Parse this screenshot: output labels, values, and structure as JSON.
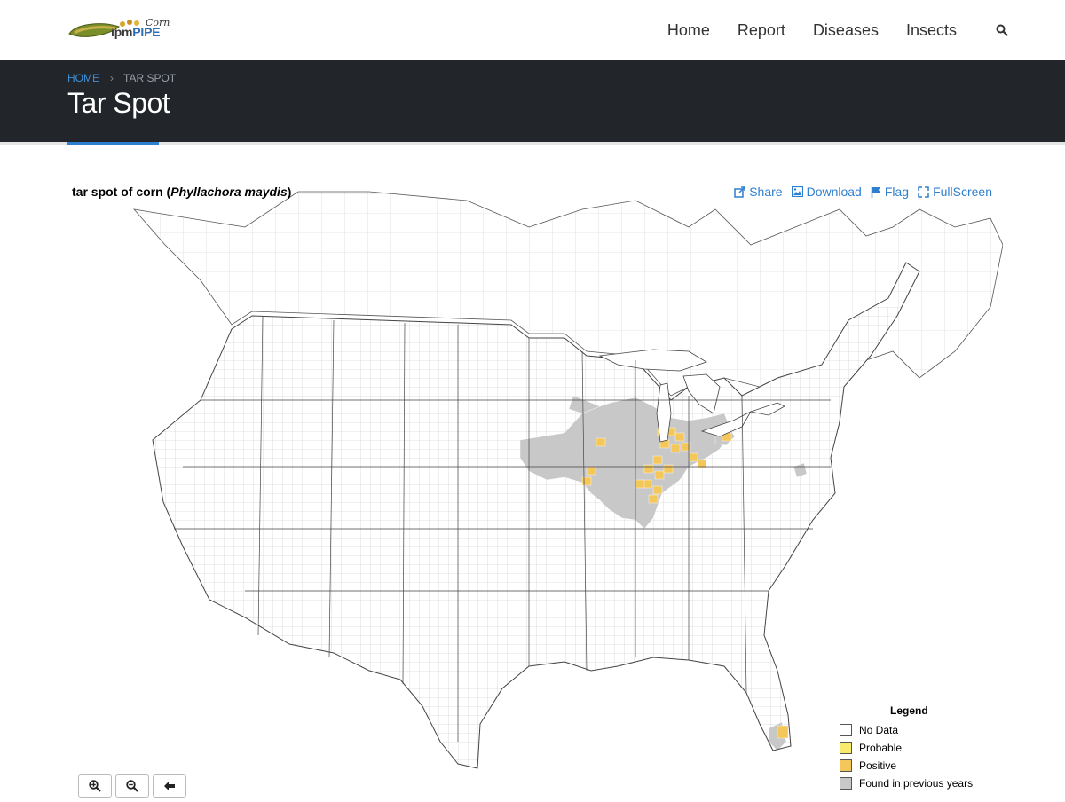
{
  "brand": {
    "corn_word": "Corn",
    "ipm_word": "ipm",
    "pipe_word": "PIPE"
  },
  "nav": {
    "items": [
      "Home",
      "Report",
      "Diseases",
      "Insects"
    ],
    "search_icon": "search-icon"
  },
  "breadcrumb": {
    "home": "HOME",
    "separator": "›",
    "current": "TAR SPOT"
  },
  "page": {
    "title": "Tar Spot"
  },
  "map": {
    "title_common": "tar spot of corn (",
    "title_scientific": "Phyllachora maydis",
    "title_close": ")",
    "tools": {
      "share": "Share",
      "download": "Download",
      "flag": "Flag",
      "fullscreen": "FullScreen"
    },
    "legend": {
      "title": "Legend",
      "items": [
        {
          "label": "No Data",
          "color": "#ffffff"
        },
        {
          "label": "Probable",
          "color": "#f7ea6c"
        },
        {
          "label": "Positive",
          "color": "#f4c75a"
        },
        {
          "label": "Found in previous years",
          "color": "#c8c8c8"
        }
      ]
    },
    "zoom": {
      "zoom_in_icon": "zoom-in-icon",
      "zoom_out_icon": "zoom-out-icon",
      "back_icon": "arrow-left-icon"
    }
  },
  "colors": {
    "accent": "#2f7fd0",
    "header_bg": "#222529",
    "positive": "#f4c75a",
    "previous": "#c8c8c8",
    "county_line": "#bdbdbd",
    "state_line": "#444444"
  }
}
